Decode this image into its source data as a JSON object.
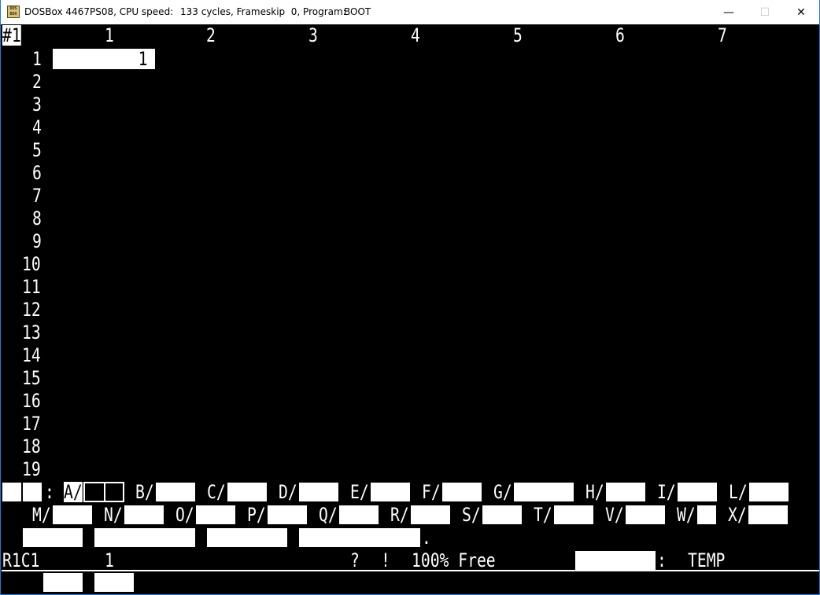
{
  "titlebar": {
    "icon_label": "DOS BOX",
    "app": "DOSBox 4467PS08, CPU speed:",
    "cycles": "133 cycles, Frameskip  0, Program:",
    "program": "BOOT",
    "minimize": "—",
    "maximize": "☐",
    "close": "✕"
  },
  "sheet": {
    "corner": "#1",
    "columns": [
      "1",
      "2",
      "3",
      "4",
      "5",
      "6",
      "7"
    ],
    "rows": [
      "1",
      "2",
      "3",
      "4",
      "5",
      "6",
      "7",
      "8",
      "9",
      "10",
      "11",
      "12",
      "13",
      "14",
      "15",
      "16",
      "17",
      "18",
      "19"
    ],
    "active_cell_value": "1"
  },
  "menu": {
    "colon": ":",
    "items": [
      {
        "key": "A/"
      },
      {
        "key": "B/"
      },
      {
        "key": "C/"
      },
      {
        "key": "D/"
      },
      {
        "key": "E/"
      },
      {
        "key": "F/"
      },
      {
        "key": "G/"
      },
      {
        "key": "H/"
      },
      {
        "key": "I/"
      },
      {
        "key": "L/"
      },
      {
        "key": "M/"
      },
      {
        "key": "N/"
      },
      {
        "key": "O/"
      },
      {
        "key": "P/"
      },
      {
        "key": "Q/"
      },
      {
        "key": "R/"
      },
      {
        "key": "S/"
      },
      {
        "key": "T/"
      },
      {
        "key": "V/"
      },
      {
        "key": "W/"
      },
      {
        "key": "X/"
      }
    ],
    "period": "."
  },
  "status": {
    "cell_ref": "R1C1",
    "cell_content": "1",
    "question": "?",
    "bang": "!",
    "memory": "100% Free",
    "colon": ":",
    "file": "TEMP"
  }
}
